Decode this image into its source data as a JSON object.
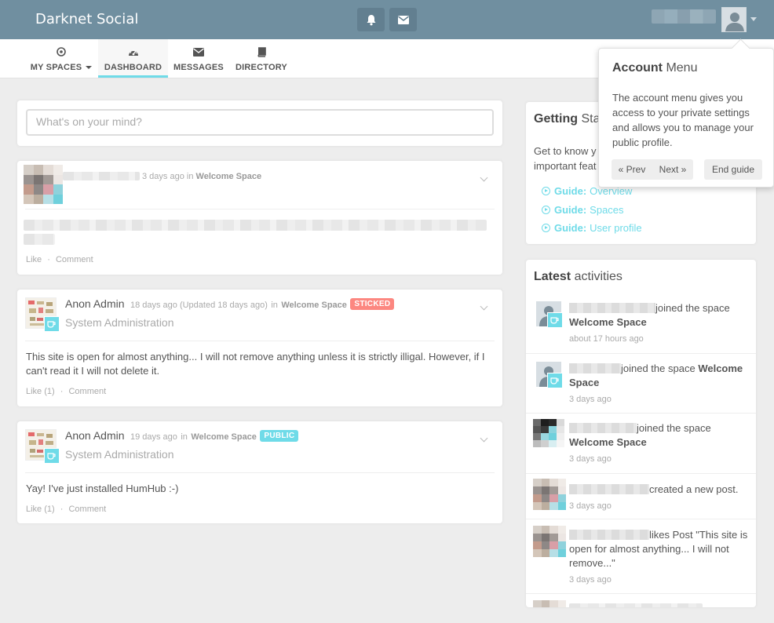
{
  "app": {
    "brand": "Darknet Social"
  },
  "nav": {
    "items": [
      {
        "label": "MY SPACES",
        "icon": "compass-icon"
      },
      {
        "label": "DASHBOARD",
        "icon": "dashboard-icon",
        "active": true
      },
      {
        "label": "MESSAGES",
        "icon": "envelope-icon"
      },
      {
        "label": "DIRECTORY",
        "icon": "book-icon"
      }
    ]
  },
  "composer": {
    "placeholder": "What's on your mind?"
  },
  "posts": [
    {
      "meta": {
        "time": "3 days ago",
        "in": "in",
        "space": "Welcome Space"
      },
      "actions": {
        "like": "Like",
        "sep": "·",
        "comment": "Comment"
      }
    },
    {
      "author": "Anon Admin",
      "meta": {
        "time": "18 days ago (Updated 18 days ago)",
        "in": "in",
        "space": "Welcome Space"
      },
      "badge": "STICKED",
      "subtitle": "System Administration",
      "text": "This site is open for almost anything... I will not remove anything unless it is strictly illigal. However, if I can't read it I will not delete it.",
      "actions": {
        "like": "Like (1)",
        "sep": "·",
        "comment": "Comment"
      }
    },
    {
      "author": "Anon Admin",
      "meta": {
        "time": "19 days ago",
        "in": "in",
        "space": "Welcome Space"
      },
      "badge": "PUBLIC",
      "subtitle": "System Administration",
      "text": "Yay! I've just installed HumHub :-)",
      "actions": {
        "like": "Like (1)",
        "sep": "·",
        "comment": "Comment"
      }
    }
  ],
  "getting_started": {
    "title_bold": "Getting",
    "title_rest": "Sta",
    "intro_line1": "Get to know y",
    "intro_line2": "important feat",
    "guides": [
      {
        "prefix": "Guide:",
        "label": "Overview"
      },
      {
        "prefix": "Guide:",
        "label": "Spaces"
      },
      {
        "prefix": "Guide:",
        "label": "User profile"
      }
    ]
  },
  "activities": {
    "title_bold": "Latest",
    "title_rest": "activities",
    "items": [
      {
        "text": "joined the space",
        "space": "Welcome Space",
        "time": "about 17 hours ago"
      },
      {
        "text": "joined the space",
        "space_inline": "Welcome",
        "space_rest": "Space",
        "time": "3 days ago"
      },
      {
        "text": "joined the space",
        "space": "Welcome Space",
        "time": "3 days ago"
      },
      {
        "text": "created a new post.",
        "time": "3 days ago"
      },
      {
        "text": "likes Post \"This site is open for almost anything... I will not remove...\"",
        "time": "3 days ago"
      }
    ]
  },
  "popover": {
    "title_bold": "Account",
    "title_rest": "Menu",
    "body": "The account menu gives you access to your private settings and allows you to manage your public profile.",
    "prev": "« Prev",
    "next": "Next »",
    "end": "End guide"
  },
  "colors": {
    "topbar": "#708fa0",
    "accent": "#6fdbe8",
    "sticked": "#fc8780",
    "public": "#6fdbe8"
  }
}
